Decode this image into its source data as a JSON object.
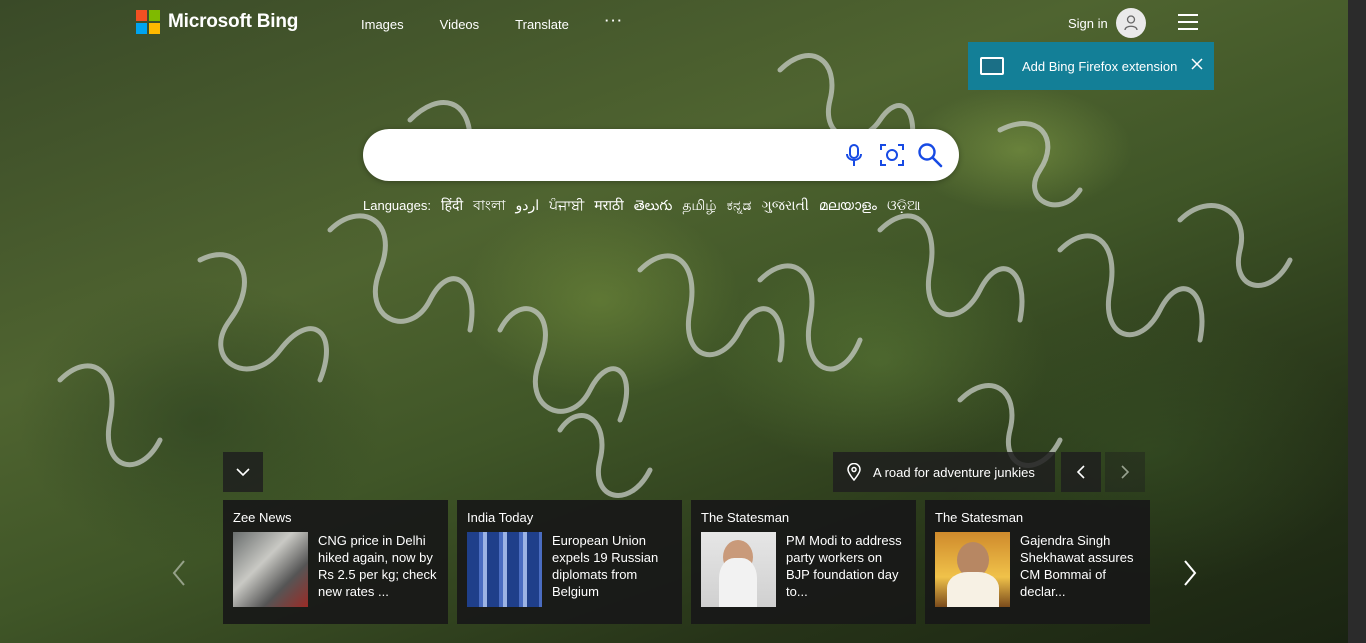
{
  "brand": {
    "name": "Microsoft Bing",
    "logo_colors": [
      "#f25022",
      "#7fba00",
      "#00a4ef",
      "#ffb900"
    ]
  },
  "nav": {
    "items": [
      "Images",
      "Videos",
      "Translate"
    ],
    "more": "···"
  },
  "account": {
    "signin_label": "Sign in",
    "avatar_icon": "user-icon",
    "menu_icon": "hamburger-icon"
  },
  "extension_banner": {
    "label": "Add Bing Firefox extension",
    "color": "#137f97"
  },
  "search": {
    "value": "",
    "placeholder": "",
    "icons": [
      "microphone-icon",
      "visual-search-icon",
      "search-icon"
    ],
    "accent": "#174ae4"
  },
  "languages": {
    "label": "Languages:",
    "items": [
      "हिंदी",
      "বাংলা",
      "اردو",
      "ਪੰਜਾਬੀ",
      "मराठी",
      "తెలుగు",
      "தமிழ்",
      "ಕನ್ನಡ",
      "ગુજરાતી",
      "മലയാളം",
      "ଓଡ଼ିଆ"
    ]
  },
  "image_info": {
    "caption": "A road for adventure junkies"
  },
  "news": [
    {
      "source": "Zee News",
      "title": "CNG price in Delhi hiked again, now by Rs 2.5 per kg; check new rates ..."
    },
    {
      "source": "India Today",
      "title": "European Union expels 19 Russian diplomats from Belgium"
    },
    {
      "source": "The Statesman",
      "title": "PM Modi to address party workers on BJP foundation day to..."
    },
    {
      "source": "The Statesman",
      "title": "Gajendra Singh Shekhawat assures CM Bommai of declar..."
    }
  ]
}
